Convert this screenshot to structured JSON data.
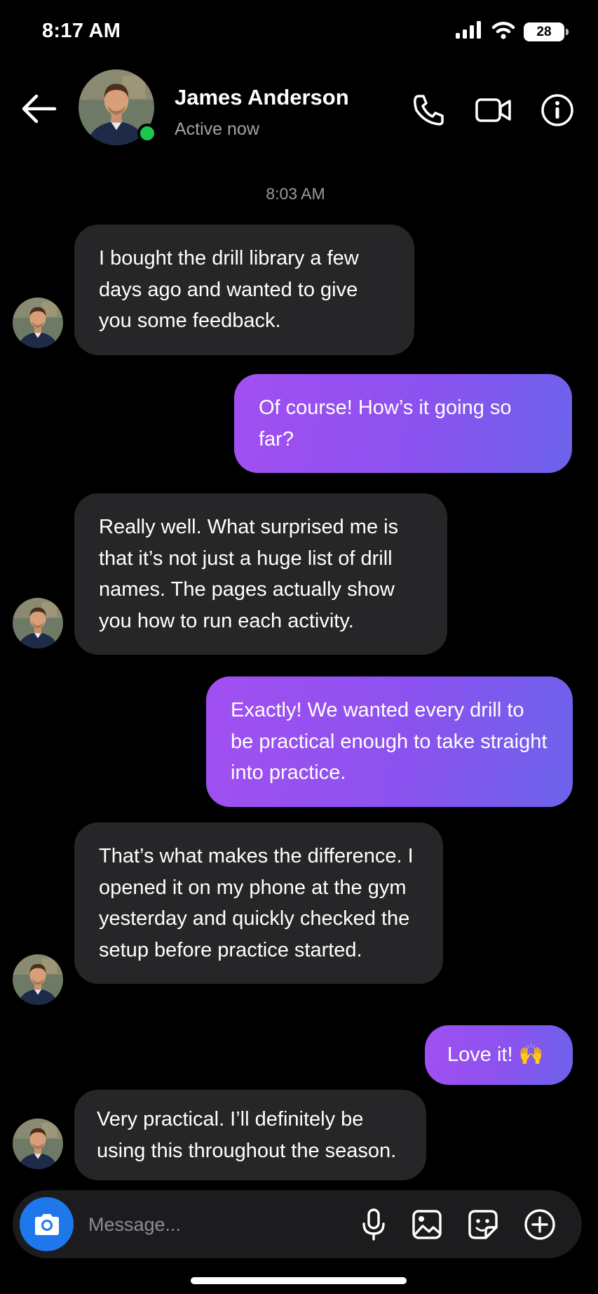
{
  "status_bar": {
    "time": "8:17 AM",
    "battery": "28"
  },
  "header": {
    "contact_name": "James Anderson",
    "contact_status": "Active now"
  },
  "chat": {
    "timestamp": "8:03 AM",
    "messages": [
      {
        "sender": "contact",
        "text": "I bought the drill library a few days ago and wanted to give you some feedback."
      },
      {
        "sender": "me",
        "text": "Of course! How’s it going so far?"
      },
      {
        "sender": "contact",
        "text": "Really well. What surprised me is that it’s not just a huge list of drill names. The pages actually show you how to run each activity."
      },
      {
        "sender": "me",
        "text": "Exactly! We wanted every drill to be practical enough to take straight into practice."
      },
      {
        "sender": "contact",
        "text": "That’s what makes the difference. I opened it on my phone at the gym yesterday and quickly checked the setup before practice started."
      },
      {
        "sender": "me",
        "text": "Love it! 🙌"
      },
      {
        "sender": "contact",
        "text": "Very practical. I’ll definitely be using this throughout the season."
      }
    ]
  },
  "composer": {
    "placeholder": "Message..."
  },
  "colors": {
    "background": "#000000",
    "incoming_bubble": "#262628",
    "outgoing_gradient_start": "#a24ff1",
    "outgoing_gradient_end": "#6c63eb",
    "camera_button": "#1e78ec",
    "online_dot": "#1cc54b"
  },
  "icons": [
    "cellular-icon",
    "wifi-icon",
    "battery-icon",
    "back-arrow-icon",
    "phone-icon",
    "video-camera-icon",
    "info-icon",
    "camera-icon",
    "microphone-icon",
    "image-icon",
    "sticker-icon",
    "plus-icon"
  ]
}
